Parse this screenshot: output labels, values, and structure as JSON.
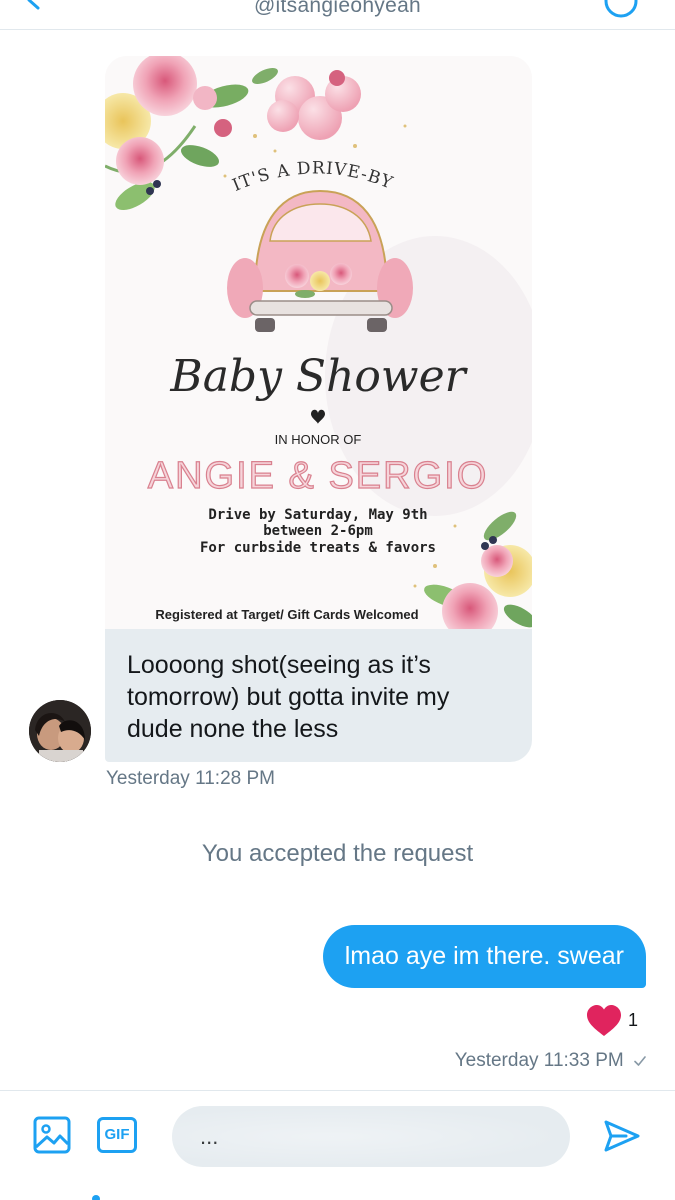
{
  "header": {
    "handle": "@itsangieohyeah"
  },
  "messages": {
    "incoming": {
      "invite": {
        "headline": "IT'S A DRIVE-BY",
        "script_title": "Baby Shower",
        "in_honor": "IN HONOR OF",
        "names": "ANGIE & SERGIO",
        "details": [
          "Drive by Saturday, May 9th",
          "between 2-6pm",
          "For curbside treats & favors"
        ],
        "registry": "Registered at Target/ Gift Cards Welcomed"
      },
      "text": "Loooong shot(seeing as it’s tomorrow) but gotta invite my dude none the less",
      "timestamp": "Yesterday 11:28 PM"
    },
    "system": "You accepted the request",
    "outgoing": {
      "text": "lmao aye im there. swear",
      "reaction_count": "1",
      "timestamp": "Yesterday 11:33 PM"
    }
  },
  "composer": {
    "gif_label": "GIF",
    "placeholder": "",
    "value": "..."
  },
  "colors": {
    "accent": "#1da1f2",
    "bubble_in": "#e6ecf0",
    "meta_text": "#657786",
    "heart": "#e0245e",
    "invite_pink": "#e89aa6"
  },
  "icons": [
    "back-chevron-icon",
    "info-icon",
    "heart-icon",
    "check-icon",
    "image-icon",
    "gif-icon",
    "send-icon"
  ]
}
